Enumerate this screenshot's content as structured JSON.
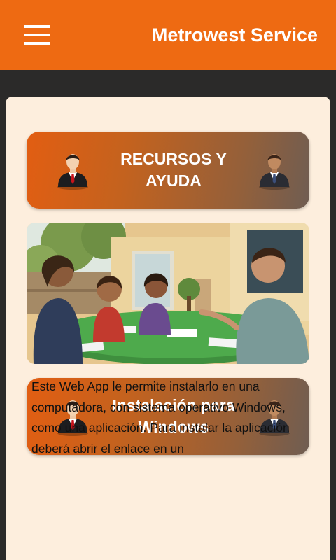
{
  "appbar": {
    "title": "Metrowest Service",
    "menu_icon": "hamburger-menu-icon",
    "color": "#ee6a12"
  },
  "card": {
    "banner_resources": {
      "label": "RECURSOS Y AYUDA",
      "left_icon": "businessman-red-tie-icon",
      "right_icon": "businessman-blue-tie-icon"
    },
    "illustration": {
      "icon": "family-meeting-illustration"
    },
    "banner_windows": {
      "label": "Instalación para Windows",
      "left_icon": "businessman-red-tie-icon",
      "right_icon": "businessman-blue-tie-icon"
    },
    "paragraph": "Este Web App le permite instalarlo en una computadora, con sistema operativo Windows, como una aplicación. Para instalar la aplicación deberá abrir el enlace en un"
  },
  "colors": {
    "background": "#2b2a29",
    "card": "#fdeedd",
    "banner_start": "#e25e12",
    "banner_end": "#6f5d52"
  }
}
